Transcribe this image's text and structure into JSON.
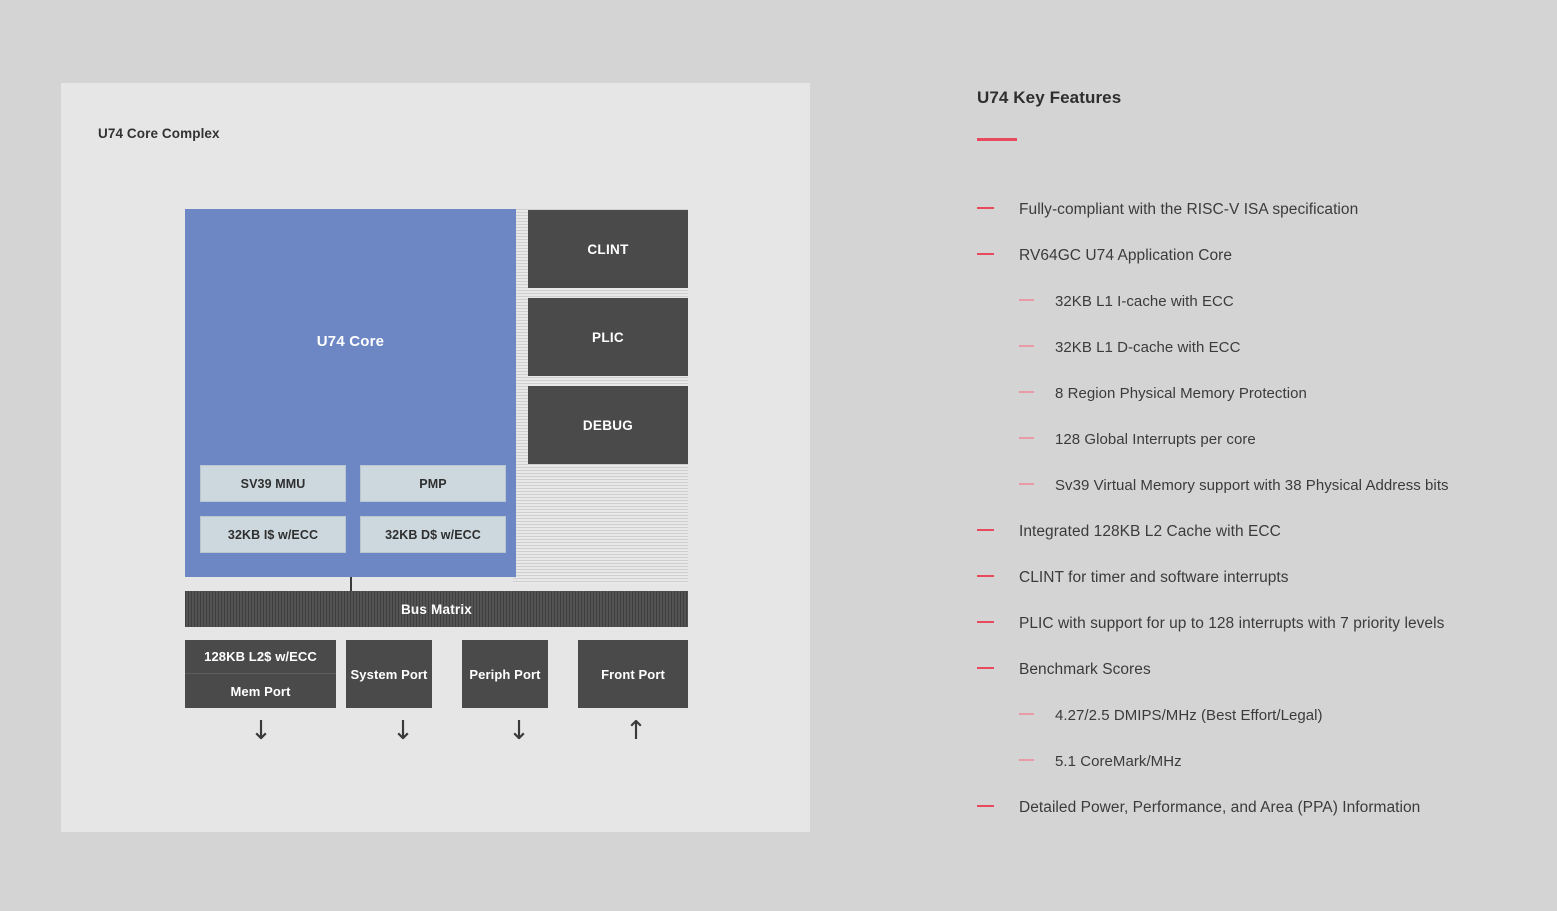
{
  "diagram": {
    "title": "U74 Core Complex",
    "core_label": "U74 Core",
    "right_blocks": [
      {
        "label": "CLINT"
      },
      {
        "label": "PLIC"
      },
      {
        "label": "DEBUG"
      }
    ],
    "core_sub_blocks": [
      {
        "label": "SV39 MMU"
      },
      {
        "label": "PMP"
      },
      {
        "label": "32KB I$ w/ECC"
      },
      {
        "label": "32KB D$ w/ECC"
      }
    ],
    "bus_matrix_label": "Bus Matrix",
    "ports": [
      {
        "label": "128KB L2$ w/ECC"
      },
      {
        "label": "Mem Port"
      },
      {
        "label": "System Port"
      },
      {
        "label": "Periph Port"
      },
      {
        "label": "Front Port"
      }
    ],
    "arrows": [
      {
        "name": "mem-port-arrow",
        "glyph": "↓"
      },
      {
        "name": "system-port-arrow",
        "glyph": "↓"
      },
      {
        "name": "periph-port-arrow",
        "glyph": "↓"
      },
      {
        "name": "front-port-arrow",
        "glyph": "↑"
      }
    ],
    "colors": {
      "core_blue": "#6d87c4",
      "sub_block": "#ccd8de",
      "dark_block": "#4a4a4a",
      "panel_bg": "#e6e6e6",
      "page_bg": "#d4d4d4"
    }
  },
  "features": {
    "title": "U74 Key Features",
    "accent_color": "#e8495c",
    "sub_accent_color": "#e89aa5",
    "items": [
      {
        "level": 1,
        "text": "Fully-compliant with the RISC-V ISA specification"
      },
      {
        "level": 1,
        "text": "RV64GC U74 Application Core"
      },
      {
        "level": 2,
        "text": "32KB L1 I-cache with ECC"
      },
      {
        "level": 2,
        "text": "32KB L1 D-cache with ECC"
      },
      {
        "level": 2,
        "text": "8 Region Physical Memory Protection"
      },
      {
        "level": 2,
        "text": "128 Global Interrupts per core"
      },
      {
        "level": 2,
        "text": "Sv39 Virtual Memory support with 38 Physical Address bits"
      },
      {
        "level": 1,
        "text": "Integrated 128KB L2 Cache with ECC"
      },
      {
        "level": 1,
        "text": "CLINT for timer and software interrupts"
      },
      {
        "level": 1,
        "text": "PLIC with support for up to 128 interrupts with 7 priority levels"
      },
      {
        "level": 1,
        "text": "Benchmark Scores"
      },
      {
        "level": 2,
        "text": "4.27/2.5 DMIPS/MHz (Best Effort/Legal)"
      },
      {
        "level": 2,
        "text": "5.1 CoreMark/MHz"
      },
      {
        "level": 1,
        "text": "Detailed Power, Performance, and Area (PPA) Information"
      }
    ]
  }
}
